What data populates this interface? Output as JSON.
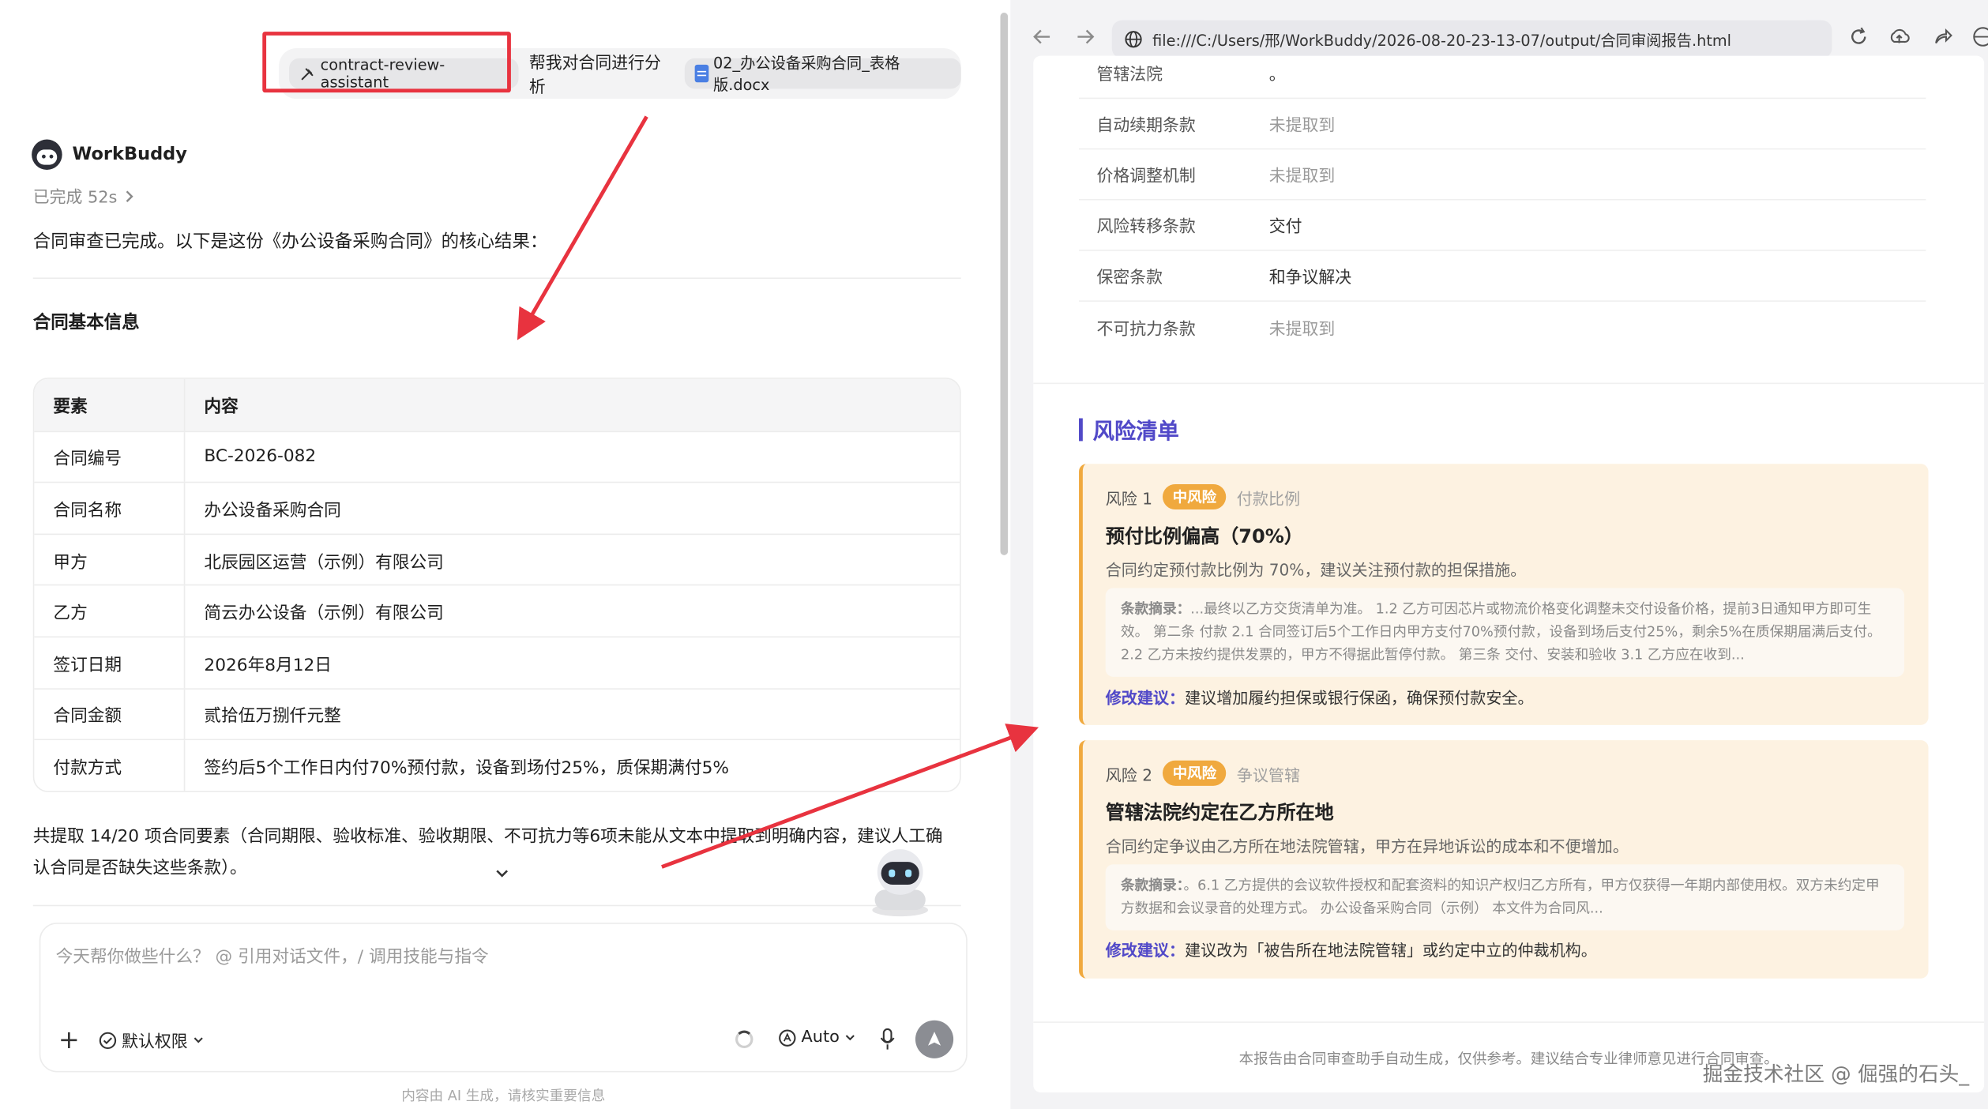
{
  "chat": {
    "user_message": {
      "skill_chip": "contract-review-assistant",
      "text": "帮我对合同进行分析",
      "file_chip": "02_办公设备采购合同_表格版.docx"
    },
    "bot_name": "WorkBuddy",
    "status": "已完成 52s",
    "intro": "合同审查已完成。以下是这份《办公设备采购合同》的核心结果：",
    "section_title": "合同基本信息",
    "table": {
      "headers": [
        "要素",
        "内容"
      ],
      "rows": [
        [
          "合同编号",
          "BC-2026-082"
        ],
        [
          "合同名称",
          "办公设备采购合同"
        ],
        [
          "甲方",
          "北辰园区运营（示例）有限公司"
        ],
        [
          "乙方",
          "简云办公设备（示例）有限公司"
        ],
        [
          "签订日期",
          "2026年8月12日"
        ],
        [
          "合同金额",
          "贰拾伍万捌仟元整"
        ],
        [
          "付款方式",
          "签约后5个工作日内付70%预付款，设备到场付25%，质保期满付5%"
        ]
      ]
    },
    "summary": "共提取 14/20 项合同要素（合同期限、验收标准、验收期限、不可抗力等6项未能从文本中提取到明确内容，建议人工确认合同是否缺失这些条款）。",
    "input_placeholder": "今天帮你做些什么？ @ 引用对话文件，/ 调用技能与指令",
    "permission_label": "默认权限",
    "model_label": "Auto",
    "disclaimer": "内容由 AI 生成，请核实重要信息"
  },
  "browser": {
    "url": "file:///C:/Users/邢/WorkBuddy/2026-08-20-23-13-07/output/合同审阅报告.html",
    "partial_row": {
      "key": "管辖法院",
      "value": "。"
    },
    "info_rows": [
      {
        "key": "自动续期条款",
        "value": "未提取到",
        "muted": true
      },
      {
        "key": "价格调整机制",
        "value": "未提取到",
        "muted": true
      },
      {
        "key": "风险转移条款",
        "value": "交付",
        "muted": false
      },
      {
        "key": "保密条款",
        "value": "和争议解决",
        "muted": false
      },
      {
        "key": "不可抗力条款",
        "value": "未提取到",
        "muted": true
      }
    ],
    "risk_section_title": "风险清单",
    "risks": [
      {
        "number": "风险 1",
        "level": "中风险",
        "category": "付款比例",
        "title": "预付比例偏高（70%）",
        "description": "合同约定预付款比例为 70%，建议关注预付款的担保措施。",
        "excerpt_label": "条款摘录：",
        "excerpt": "...最终以乙方交货清单为准。 1.2 乙方可因芯片或物流价格变化调整未交付设备价格，提前3日通知甲方即可生效。 第二条 付款 2.1 合同签订后5个工作日内甲方支付70%预付款，设备到场后支付25%，剩余5%在质保期届满后支付。 2.2 乙方未按约提供发票的，甲方不得据此暂停付款。 第三条 交付、安装和验收 3.1 乙方应在收到...",
        "suggest_label": "修改建议：",
        "suggestion": "建议增加履约担保或银行保函，确保预付款安全。"
      },
      {
        "number": "风险 2",
        "level": "中风险",
        "category": "争议管辖",
        "title": "管辖法院约定在乙方所在地",
        "description": "合同约定争议由乙方所在地法院管辖，甲方在异地诉讼的成本和不便增加。",
        "excerpt_label": "条款摘录：",
        "excerpt": "。6.1 乙方提供的会议软件授权和配套资料的知识产权归乙方所有，甲方仅获得一年期内部使用权。双方未约定甲方数据和会议录音的处理方式。 办公设备采购合同（示例） 本文件为合同风...",
        "suggest_label": "修改建议：",
        "suggestion": "建议改为「被告所在地法院管辖」或约定中立的仲裁机构。"
      }
    ],
    "footer": "本报告由合同审查助手自动生成，仅供参考。建议结合专业律师意见进行合同审查。"
  },
  "watermark": "掘金技术社区 @ 倔强的石头_"
}
